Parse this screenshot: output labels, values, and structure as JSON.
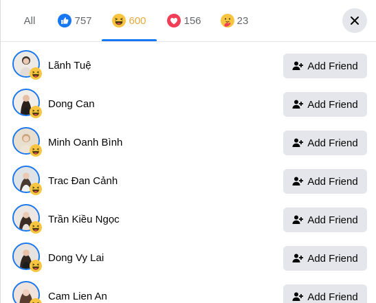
{
  "tabs": [
    {
      "key": "all",
      "label": "All",
      "count": ""
    },
    {
      "key": "like",
      "label": "",
      "count": "757",
      "icon": "like-reaction-icon"
    },
    {
      "key": "haha",
      "label": "",
      "count": "600",
      "icon": "haha-reaction-icon",
      "active": true
    },
    {
      "key": "love",
      "label": "",
      "count": "156",
      "icon": "love-reaction-icon"
    },
    {
      "key": "care",
      "label": "",
      "count": "23",
      "icon": "care-reaction-icon"
    }
  ],
  "close_icon": "close-icon",
  "colors": {
    "active_tab_text": "#e7a93c",
    "active_underline": "#1877f2",
    "button_bg": "#e4e6eb",
    "avatar_ring": "#1877f2"
  },
  "people": [
    {
      "name": "Lãnh Tuệ",
      "button": "Add Friend"
    },
    {
      "name": "Dong Can",
      "button": "Add Friend"
    },
    {
      "name": "Minh Oanh Bình",
      "button": "Add Friend"
    },
    {
      "name": "Trac Đan Cảnh",
      "button": "Add Friend"
    },
    {
      "name": "Trần Kiều Ngọc",
      "button": "Add Friend"
    },
    {
      "name": "Dong Vy Lai",
      "button": "Add Friend"
    },
    {
      "name": "Cam Lien An",
      "button": "Add Friend"
    }
  ]
}
